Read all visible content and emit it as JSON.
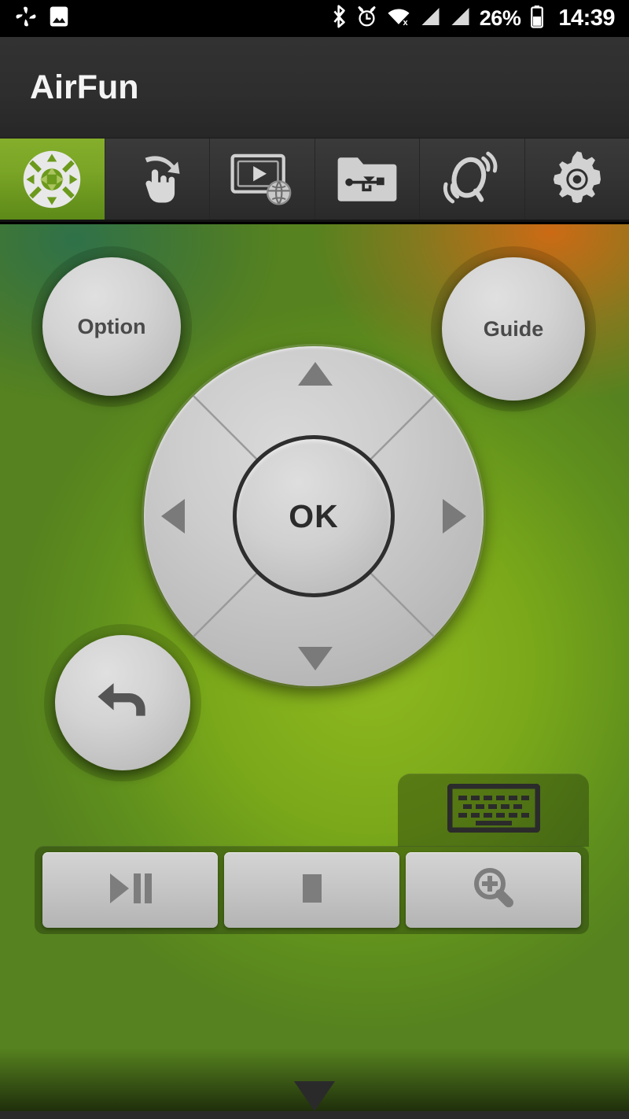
{
  "status_bar": {
    "left_icons": [
      {
        "name": "photos-pinwheel-icon",
        "label": "Photos"
      },
      {
        "name": "gallery-image-icon",
        "label": "Gallery"
      }
    ],
    "right_icons": [
      {
        "name": "bluetooth-icon",
        "label": "Bluetooth"
      },
      {
        "name": "alarm-clock-icon",
        "label": "Alarm"
      },
      {
        "name": "wifi-disconnected-icon",
        "label": "Wi-Fi off"
      },
      {
        "name": "signal-bars-icon",
        "label": "Signal 1"
      },
      {
        "name": "signal-bars-icon-2",
        "label": "Signal 2"
      },
      {
        "name": "battery-icon",
        "label": "Battery"
      }
    ],
    "battery_percent": "26%",
    "time": "14:39"
  },
  "header": {
    "app_title": "AirFun"
  },
  "tabs": [
    {
      "id": "dpad",
      "icon": "dpad-icon",
      "label": "Remote",
      "active": true
    },
    {
      "id": "touchpad",
      "icon": "swipe-hand-icon",
      "label": "Touchpad",
      "active": false
    },
    {
      "id": "media",
      "icon": "video-globe-icon",
      "label": "Web Video",
      "active": false
    },
    {
      "id": "files",
      "icon": "usb-folder-icon",
      "label": "USB Files",
      "active": false
    },
    {
      "id": "audio",
      "icon": "speaker-waves-icon",
      "label": "Audio",
      "active": false
    },
    {
      "id": "settings",
      "icon": "gear-icon",
      "label": "Settings",
      "active": false
    }
  ],
  "remote": {
    "option_label": "Option",
    "guide_label": "Guide",
    "ok_label": "OK",
    "back_icon": "back-arrow-icon",
    "dpad": {
      "up_icon": "arrow-up-icon",
      "down_icon": "arrow-down-icon",
      "left_icon": "arrow-left-icon",
      "right_icon": "arrow-right-icon"
    },
    "keyboard_tab": {
      "icon": "keyboard-icon",
      "label": "Keyboard"
    },
    "media_buttons": [
      {
        "id": "playpause",
        "icon": "play-pause-icon",
        "label": "Play / Pause"
      },
      {
        "id": "stop",
        "icon": "stop-icon",
        "label": "Stop"
      },
      {
        "id": "zoomin",
        "icon": "zoom-in-icon",
        "label": "Zoom In"
      }
    ],
    "drawer_handle_icon": "chevron-down-icon"
  },
  "colors": {
    "accent_green": "#7aa526",
    "panel_dark": "#2e2e2e",
    "status_bar_bg": "#000000",
    "button_face": "#cccccc",
    "icon_gray": "#7a7a7a"
  }
}
